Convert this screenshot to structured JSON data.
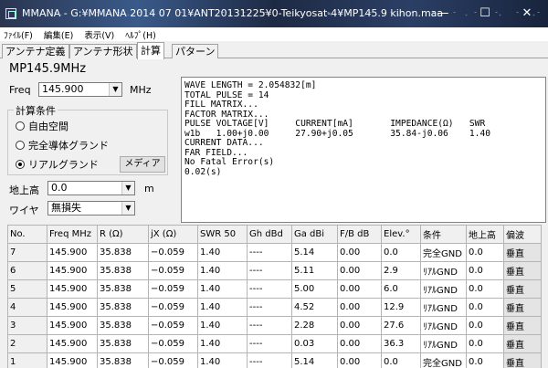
{
  "window": {
    "title": "MMANA - G:¥MMANA 2014 07 01¥ANT20131225¥0-Teikyosat-4¥MP145.9 kihon.maa",
    "minimize": "—",
    "maximize": "☐",
    "close": "✕"
  },
  "menu": [
    "ﾌｧｲﾙ(F)",
    "編集(E)",
    "表示(V)",
    "ﾍﾙﾌﾟ(H)"
  ],
  "tabs": [
    "アンテナ定義",
    "アンテナ形状",
    "計算",
    "パターン"
  ],
  "active_tab": 2,
  "antenna_name": "MP145.9MHz",
  "freq": {
    "label": "Freq",
    "value": "145.900",
    "unit": "MHz"
  },
  "conditions": {
    "legend": "計算条件",
    "options": [
      "自由空間",
      "完全導体グランド",
      "リアルグランド"
    ],
    "selected": 2,
    "media_button": "メディア"
  },
  "height": {
    "label": "地上高",
    "value": "0.0",
    "unit": "m"
  },
  "wire": {
    "label": "ワイヤ",
    "value": "無損失"
  },
  "output_text": "WAVE LENGTH = 2.054832[m]\nTOTAL PULSE = 14\nFILL MATRIX...\nFACTOR MATRIX...\nPULSE VOLTAGE[V]     CURRENT[mA]       IMPEDANCE(Ω)   SWR\nw1b   1.00+j0.00     27.90+j0.05       35.84-j0.06    1.40\nCURRENT DATA...\nFAR FIELD...\nNo Fatal Error(s)\n0.02(s)",
  "table": {
    "headers": [
      "No.",
      "Freq MHz",
      "R (Ω)",
      "jX (Ω)",
      "SWR 50",
      "Gh dBd",
      "Ga dBi",
      "F/B dB",
      "Elev.°",
      "条件",
      "地上高",
      "偏波"
    ],
    "rows": [
      [
        "7",
        "145.900",
        "35.838",
        "−0.059",
        "1.40",
        "----",
        "5.14",
        "0.00",
        "0.0",
        "完全GND",
        "0.0",
        "垂直"
      ],
      [
        "6",
        "145.900",
        "35.838",
        "−0.059",
        "1.40",
        "----",
        "5.11",
        "0.00",
        "2.9",
        "ﾘｱﾙGND",
        "0.0",
        "垂直"
      ],
      [
        "5",
        "145.900",
        "35.838",
        "−0.059",
        "1.40",
        "----",
        "5.00",
        "0.00",
        "6.0",
        "ﾘｱﾙGND",
        "0.0",
        "垂直"
      ],
      [
        "4",
        "145.900",
        "35.838",
        "−0.059",
        "1.40",
        "----",
        "4.52",
        "0.00",
        "12.9",
        "ﾘｱﾙGND",
        "0.0",
        "垂直"
      ],
      [
        "3",
        "145.900",
        "35.838",
        "−0.059",
        "1.40",
        "----",
        "2.28",
        "0.00",
        "27.6",
        "ﾘｱﾙGND",
        "0.0",
        "垂直"
      ],
      [
        "2",
        "145.900",
        "35.838",
        "−0.059",
        "1.40",
        "----",
        "0.03",
        "0.00",
        "36.3",
        "ﾘｱﾙGND",
        "0.0",
        "垂直"
      ],
      [
        "1",
        "145.900",
        "35.838",
        "−0.059",
        "1.40",
        "----",
        "5.14",
        "0.00",
        "0.0",
        "完全GND",
        "0.0",
        "垂直"
      ]
    ]
  }
}
